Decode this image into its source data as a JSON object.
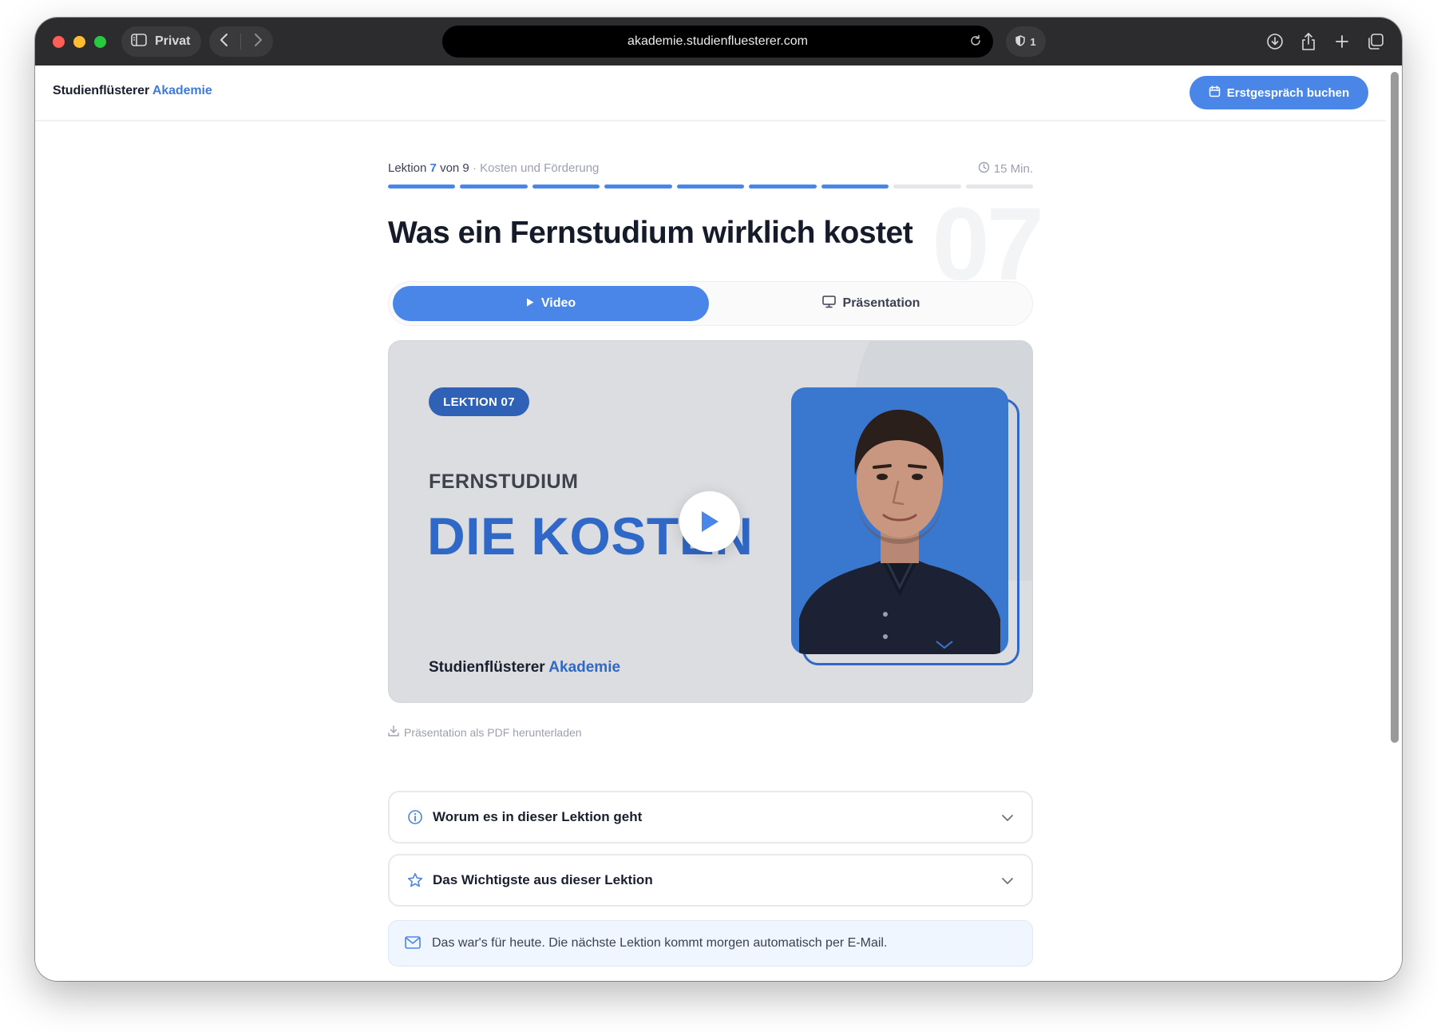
{
  "browser": {
    "private_label": "Privat",
    "url": "akademie.studienfluesterer.com",
    "shield_count": "1"
  },
  "header": {
    "brand_main": "Studienflüsterer",
    "brand_accent": "Akademie",
    "cta_label": "Erstgespräch buchen"
  },
  "lesson": {
    "prefix": "Lektion",
    "number": "7",
    "of_text": "von 9",
    "separator": "·",
    "topic": "Kosten und Förderung",
    "duration": "15 Min.",
    "progress": {
      "completed": 7,
      "total": 9
    },
    "big_number": "07",
    "title": "Was ein Fernstudium wirklich kostet"
  },
  "tabs": [
    {
      "label": "Video",
      "active": true
    },
    {
      "label": "Präsentation",
      "active": false
    }
  ],
  "video": {
    "badge": "LEKTION 07",
    "kicker": "FERNSTUDIUM",
    "headline": "DIE KOSTEN",
    "brand_main": "Studienflüsterer",
    "brand_accent": "Akademie"
  },
  "pdf_link": "Präsentation als PDF herunterladen",
  "accordions": [
    {
      "label": "Worum es in dieser Lektion geht",
      "icon": "info-icon"
    },
    {
      "label": "Das Wichtigste aus dieser Lektion",
      "icon": "star-icon"
    }
  ],
  "note": "Das war's für heute. Die nächste Lektion kommt morgen automatisch per E-Mail.",
  "colors": {
    "accent": "#4a86e8",
    "accent_dark": "#2f68c6",
    "title": "#161b2a",
    "muted": "#9aa1ad"
  }
}
